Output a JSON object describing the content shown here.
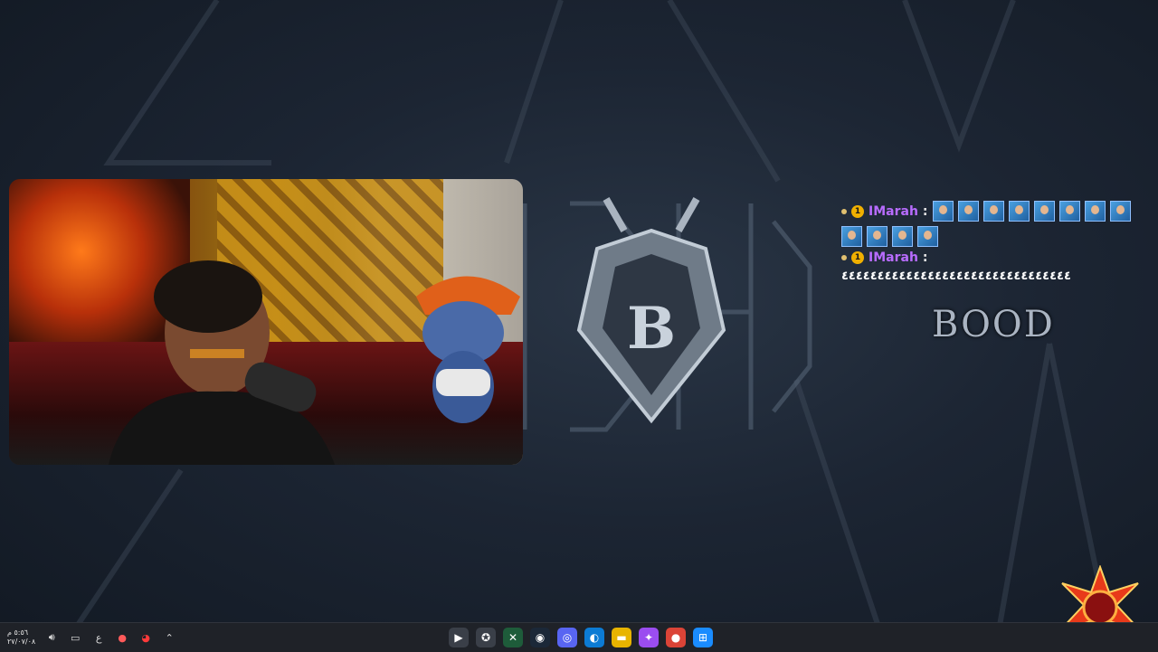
{
  "chat": {
    "messages": [
      {
        "user": "IMarah",
        "separator": ":",
        "emote_count": 12,
        "text": ""
      },
      {
        "user": "IMarah",
        "separator": ":",
        "emote_count": 0,
        "text": "٤٤٤٤٤٤٤٤٤٤٤٤٤٤٤٤٤٤٤٤٤٤٤٤٤٤٤٤٤٤٤٤"
      }
    ],
    "sub_badge": "1"
  },
  "overlay": {
    "brand_text": "BOOD"
  },
  "taskbar": {
    "clock_time": "٥:٥٦ م",
    "clock_date": "٢٧/٠٧/٠٨",
    "language": "ع",
    "apps": [
      {
        "name": "media-player",
        "glyph": "▶",
        "color": "#3a3f48"
      },
      {
        "name": "xbox",
        "glyph": "✪",
        "color": "#3a3f48"
      },
      {
        "name": "excel",
        "glyph": "✕",
        "color": "#1e5c3a"
      },
      {
        "name": "steam",
        "glyph": "◉",
        "color": "#1b2838"
      },
      {
        "name": "discord",
        "glyph": "◎",
        "color": "#5865f2"
      },
      {
        "name": "edge",
        "glyph": "◐",
        "color": "#0c7bd4"
      },
      {
        "name": "file-explorer",
        "glyph": "▬",
        "color": "#e8b400"
      },
      {
        "name": "copilot",
        "glyph": "✦",
        "color": "#9b4df0"
      },
      {
        "name": "chrome",
        "glyph": "●",
        "color": "#db4437"
      },
      {
        "name": "windows-start",
        "glyph": "⊞",
        "color": "#1a8cff"
      }
    ]
  },
  "colors": {
    "username": "#b86cff",
    "sub_badge": "#f0b000",
    "taskbar_bg": "#1f2228"
  }
}
